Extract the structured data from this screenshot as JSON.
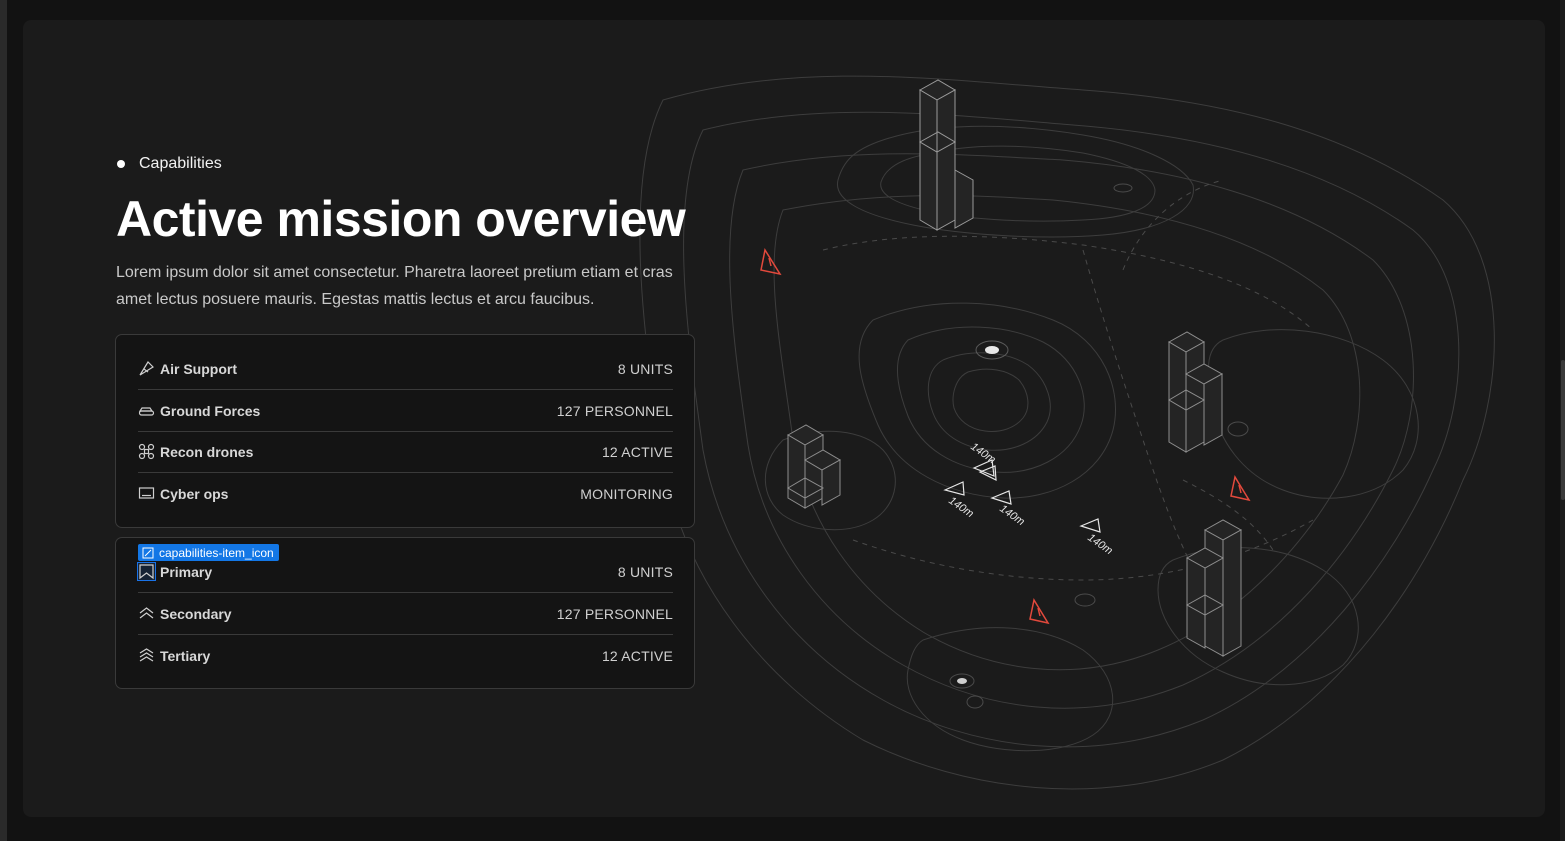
{
  "section": {
    "eyebrow": "Capabilities",
    "title": "Active mission overview",
    "description": "Lorem ipsum dolor sit amet consectetur. Pharetra laoreet pretium etiam et cras amet lectus posuere mauris. Egestas mattis lectus et arcu faucibus."
  },
  "capabilities": [
    {
      "icon": "jet-icon",
      "label": "Air Support",
      "value": "8 UNITS"
    },
    {
      "icon": "tank-icon",
      "label": "Ground Forces",
      "value": "127 PERSONNEL"
    },
    {
      "icon": "drone-icon",
      "label": "Recon drones",
      "value": "12 ACTIVE"
    },
    {
      "icon": "laptop-icon",
      "label": "Cyber ops",
      "value": "MONITORING"
    }
  ],
  "ranks": [
    {
      "icon": "chevron-rank-1-icon",
      "label": "Primary",
      "value": "8 UNITS"
    },
    {
      "icon": "chevron-rank-2-icon",
      "label": "Secondary",
      "value": "127 PERSONNEL"
    },
    {
      "icon": "chevron-rank-3-icon",
      "label": "Tertiary",
      "value": "12 ACTIVE"
    }
  ],
  "inspector_tag": "capabilities-item_icon",
  "map": {
    "altitude_labels": [
      "140m",
      "140m",
      "140m",
      "140m"
    ],
    "warning_color": "#e2493c",
    "icons": [
      "building-icon",
      "warning-icon",
      "aircraft-marker-icon",
      "beacon-icon"
    ]
  }
}
